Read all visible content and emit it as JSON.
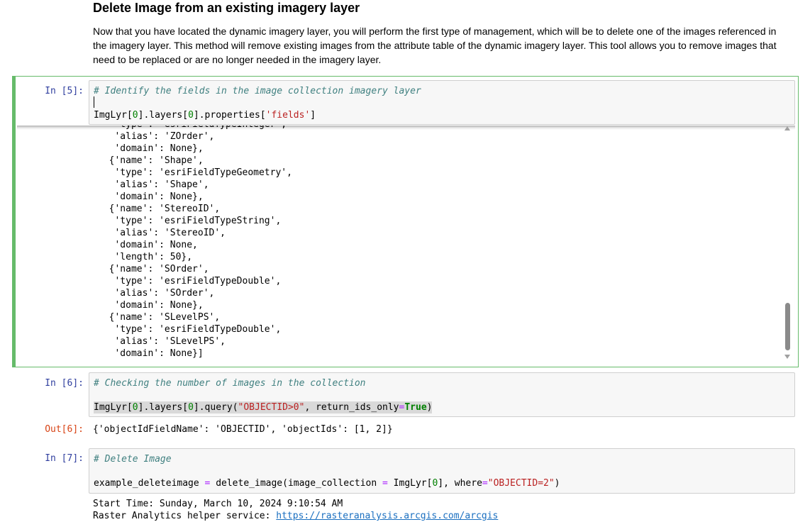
{
  "section": {
    "heading": "Delete Image from an existing imagery layer",
    "paragraph": "Now that you have located the dynamic imagery layer, you will perform the first type of management, which will be to delete one of the images referenced in the imagery layer. This method will remove existing images from the attribute table of the dynamic imagery layer. This tool allows you to remove images that need to be replaced or are no longer needed in the imagery layer."
  },
  "cell5": {
    "prompt": "In [5]:",
    "comment": "# Identify the fields in the image collection imagery layer",
    "code": {
      "p1": "ImgLyr[",
      "n1": "0",
      "p2": "].layers[",
      "n2": "0",
      "p3": "].properties[",
      "s1": "'fields'",
      "p4": "]"
    },
    "output_lines": [
      "   'type': 'esriFieldTypeInteger',",
      "   'alias': 'ZOrder',",
      "   'domain': None},",
      "  {'name': 'Shape',",
      "   'type': 'esriFieldTypeGeometry',",
      "   'alias': 'Shape',",
      "   'domain': None},",
      "  {'name': 'StereoID',",
      "   'type': 'esriFieldTypeString',",
      "   'alias': 'StereoID',",
      "   'domain': None,",
      "   'length': 50},",
      "  {'name': 'SOrder',",
      "   'type': 'esriFieldTypeDouble',",
      "   'alias': 'SOrder',",
      "   'domain': None},",
      "  {'name': 'SLevelPS',",
      "   'type': 'esriFieldTypeDouble',",
      "   'alias': 'SLevelPS',",
      "   'domain': None}]"
    ]
  },
  "cell6": {
    "prompt": "In [6]:",
    "out_prompt": "Out[6]:",
    "comment": "# Checking the number of images in the collection",
    "code": {
      "p1": "ImgLyr[",
      "n1": "0",
      "p2": "].layers[",
      "n2": "0",
      "p3": "].query(",
      "s1": "\"OBJECTID>0\"",
      "p4": ", return_ids_only",
      "op": "=",
      "kw": "True",
      "p5": ")"
    },
    "output": "{'objectIdFieldName': 'OBJECTID', 'objectIds': [1, 2]}"
  },
  "cell7": {
    "prompt": "In [7]:",
    "comment": "# Delete Image",
    "code": {
      "p1": "example_deleteimage ",
      "op1": "=",
      "p2": " delete_image(image_collection ",
      "op2": "=",
      "p3": " ImgLyr[",
      "n1": "0",
      "p4": "], where",
      "op3": "=",
      "s1": "\"OBJECTID=2\"",
      "p5": ")"
    },
    "output_line1": "Start Time: Sunday, March 10, 2024 9:10:54 AM",
    "output_line2_prefix": "Raster Analytics helper service: ",
    "output_line2_link": "https://rasteranalysis.arcgis.com/arcgis"
  },
  "scrollbar": {
    "up_icon": "triangle-up",
    "down_icon": "triangle-down"
  }
}
